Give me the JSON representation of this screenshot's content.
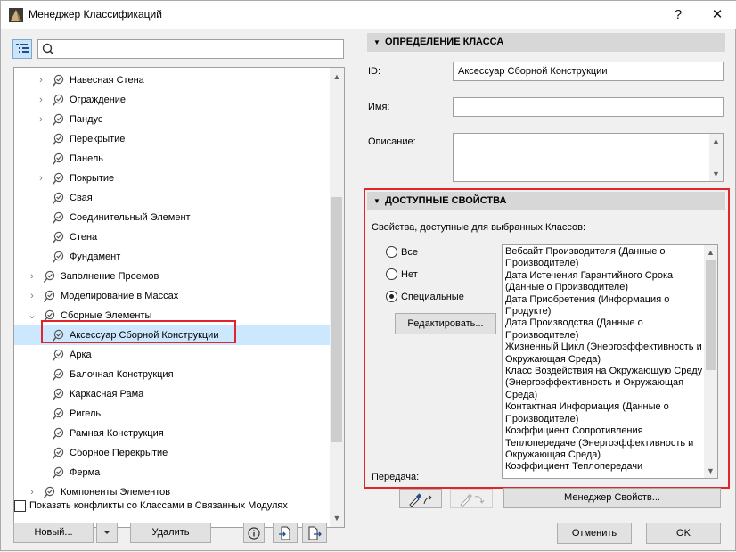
{
  "window": {
    "title": "Менеджер Классификаций",
    "help": "?",
    "close": "✕"
  },
  "tree": {
    "items": [
      {
        "label": "Навесная Стена",
        "level": 2,
        "expandable": true
      },
      {
        "label": "Ограждение",
        "level": 2,
        "expandable": true
      },
      {
        "label": "Пандус",
        "level": 2,
        "expandable": true
      },
      {
        "label": "Перекрытие",
        "level": 2,
        "expandable": false
      },
      {
        "label": "Панель",
        "level": 2,
        "expandable": false
      },
      {
        "label": "Покрытие",
        "level": 2,
        "expandable": true
      },
      {
        "label": "Свая",
        "level": 2,
        "expandable": false
      },
      {
        "label": "Соединительный Элемент",
        "level": 2,
        "expandable": false
      },
      {
        "label": "Стена",
        "level": 2,
        "expandable": false
      },
      {
        "label": "Фундамент",
        "level": 2,
        "expandable": false
      },
      {
        "label": "Заполнение Проемов",
        "level": 1,
        "expandable": true
      },
      {
        "label": "Моделирование в Массах",
        "level": 1,
        "expandable": true
      },
      {
        "label": "Сборные Элементы",
        "level": 1,
        "expanded": true
      },
      {
        "label": "Аксессуар Сборной Конструкции",
        "level": 2,
        "selected": true
      },
      {
        "label": "Арка",
        "level": 2,
        "expandable": false
      },
      {
        "label": "Балочная Конструкция",
        "level": 2,
        "expandable": false
      },
      {
        "label": "Каркасная Рама",
        "level": 2,
        "expandable": false
      },
      {
        "label": "Ригель",
        "level": 2,
        "expandable": false
      },
      {
        "label": "Рамная Конструкция",
        "level": 2,
        "expandable": false
      },
      {
        "label": "Сборное Перекрытие",
        "level": 2,
        "expandable": false
      },
      {
        "label": "Ферма",
        "level": 2,
        "expandable": false
      },
      {
        "label": "Компоненты Элементов",
        "level": 1,
        "expandable": true
      }
    ]
  },
  "show_conflicts": {
    "label": "Показать конфликты со Классами в Связанных Модулях",
    "checked": false
  },
  "bottom_left": {
    "new": "Новый...",
    "delete": "Удалить",
    "info": "i"
  },
  "class_def": {
    "header": "ОПРЕДЕЛЕНИЕ КЛАССА",
    "id_label": "ID:",
    "id_value": "Аксессуар Сборной Конструкции",
    "name_label": "Имя:",
    "name_value": "",
    "desc_label": "Описание:",
    "desc_value": ""
  },
  "props": {
    "header": "ДОСТУПНЫЕ СВОЙСТВА",
    "caption": "Свойства, доступные для выбранных Классов:",
    "radio_all": "Все",
    "radio_none": "Нет",
    "radio_special": "Специальные",
    "selected": "Специальные",
    "edit": "Редактировать...",
    "transfer": "Передача:",
    "items": [
      "Вебсайт Производителя (Данные о Производителе)",
      "Дата Истечения Гарантийного Срока (Данные о Производителе)",
      "Дата Приобретения (Информация о Продукте)",
      "Дата Производства (Данные о Производителе)",
      "Жизненный Цикл (Энергоэффективность и Окружающая Среда)",
      "Класс Воздействия на Окружающую Среду (Энергоэффективность и Окружающая Среда)",
      "Контактная Информация (Данные о Производителе)",
      "Коэффициент Сопротивления",
      "Теплопередаче (Энергоэффективность и Окружающая Среда)",
      "Коэффициент Теплопередачи"
    ],
    "manager": "Менеджер Свойств..."
  },
  "footer": {
    "cancel": "Отменить",
    "ok": "OK"
  },
  "colors": {
    "accent_red": "#e0262a",
    "selection": "#cce8ff",
    "section_header": "#d7d7d7"
  }
}
